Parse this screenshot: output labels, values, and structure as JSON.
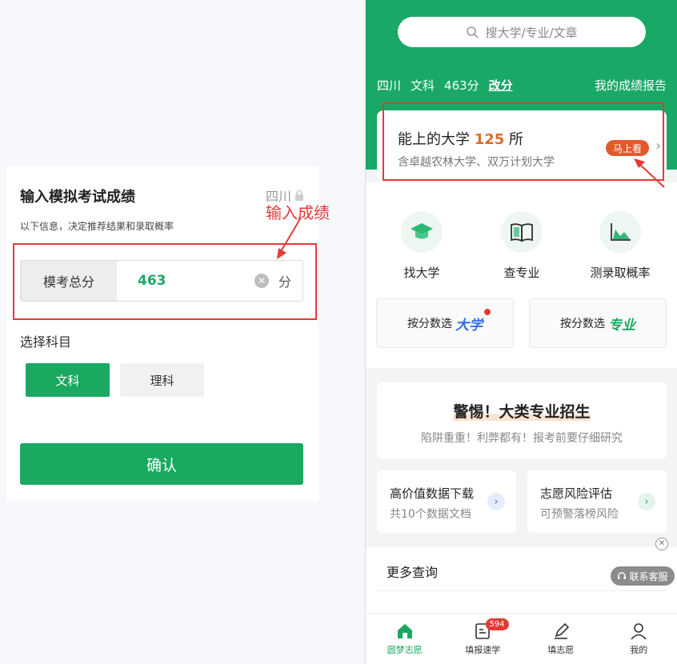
{
  "left": {
    "title": "输入模拟考试成绩",
    "region": "四川",
    "subtitle": "以下信息，决定推荐结果和录取概率",
    "annotation": "输入成绩",
    "score_label": "模考总分",
    "score_value": "463",
    "score_unit": "分",
    "subject_title": "选择科目",
    "subjects": [
      "文科",
      "理科"
    ],
    "selected_subject": "文科",
    "confirm": "确认"
  },
  "right": {
    "search_placeholder": "搜大学/专业/文章",
    "info_region": "四川",
    "info_subject": "文科",
    "info_score": "463分",
    "info_edit": "改分",
    "info_report": "我的成绩报告",
    "uni_prefix": "能上的大学",
    "uni_count": "125",
    "uni_suffix": "所",
    "uni_desc": "含卓越农林大学、双万计划大学",
    "uni_btn": "马上看",
    "icons": [
      {
        "label": "找大学",
        "icon": "graduation-cap-icon"
      },
      {
        "label": "查专业",
        "icon": "book-icon"
      },
      {
        "label": "测录取概率",
        "icon": "chart-icon"
      }
    ],
    "filter1_prefix": "按分数选",
    "filter1_accent": "大学",
    "filter2_prefix": "按分数选",
    "filter2_accent": "专业",
    "warn_title": "警惕！大类专业招生",
    "warn_sub": "陷阱重重！利弊都有！报考前要仔细研究",
    "card1_title": "高价值数据下载",
    "card1_sub": "共10个数据文档",
    "card2_title": "志愿风险评估",
    "card2_sub": "可预警落榜风险",
    "more_title": "更多查询",
    "customer_service": "联系客服",
    "nav": [
      {
        "label": "圆梦志愿",
        "active": true
      },
      {
        "label": "填报速学",
        "badge": "594"
      },
      {
        "label": "填志愿"
      },
      {
        "label": "我的"
      }
    ]
  },
  "colors": {
    "brand_green": "#19a960",
    "annotation_red": "#e53935",
    "count_orange": "#e06a2c"
  }
}
